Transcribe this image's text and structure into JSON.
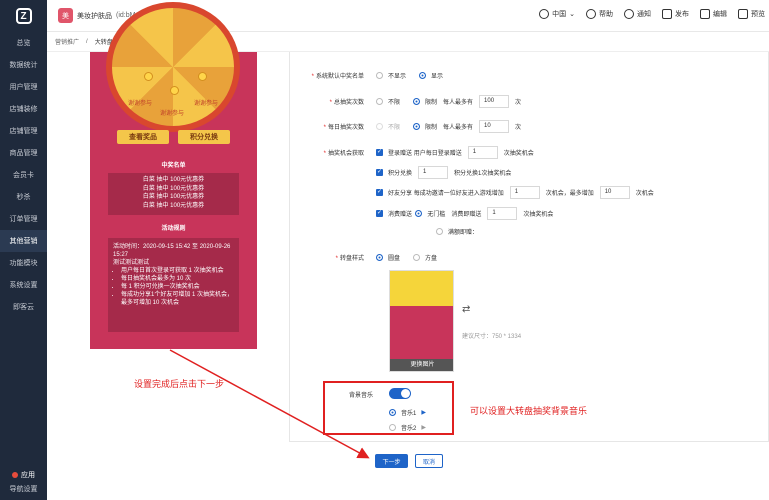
{
  "logo": "Z",
  "shop": {
    "avatar": "美",
    "name": "美妆护肤品",
    "id": "(id:bMvIMbn2Wr)"
  },
  "toolbar": {
    "region": "中国",
    "help": "帮助",
    "notice": "通知",
    "publish": "发布",
    "edit": "编辑",
    "preview": "预览"
  },
  "sidebar": {
    "items": [
      "总览",
      "数据统计",
      "用户管理",
      "店铺装修",
      "店铺管理",
      "商品管理",
      "会员卡",
      "秒杀",
      "订单管理",
      "其他营销",
      "功能模块",
      "系统设置",
      "即客云"
    ],
    "app": "应用",
    "cut": "导航设置"
  },
  "breadcrumb": {
    "parent": "营销推广",
    "sep": "/",
    "current": "大转盘"
  },
  "phone": {
    "wheel_text": [
      "谢谢参与",
      "谢谢参与",
      "谢谢参与"
    ],
    "btn_prize": "查看奖品",
    "btn_points": "积分兑换",
    "winners_title": "中奖名单",
    "winners": [
      "白菜 抽中 100元优惠券",
      "白菜 抽中 100元优惠券",
      "白菜 抽中 100元优惠券",
      "白菜 抽中 100元优惠券"
    ],
    "rules_title": "活动规则",
    "rules_time": "活动时间：2020-09-15 15:42 至 2020-09-26 15:27",
    "rules_desc": "测试测试测试",
    "rules_list": [
      "用户每日首次登录可获取 1 次抽奖机会",
      "每日抽奖机会最多为 10 次",
      "每 1 积分可兑换一次抽奖机会",
      "每成功分享1个好友可增加 1 次抽奖机会，最多可增加 10 次机会"
    ]
  },
  "form": {
    "show_list": {
      "label": "系统默认中奖名单",
      "opt_hide": "不显示",
      "opt_show": "显示"
    },
    "total": {
      "label": "总抽奖次数",
      "opt_unlimited": "不限",
      "opt_limit": "限制",
      "prefix": "每人最多有",
      "value": "100",
      "unit": "次"
    },
    "daily": {
      "label": "每日抽奖次数",
      "opt_unlimited": "不限",
      "opt_limit": "限制",
      "prefix": "每人最多有",
      "value": "10",
      "unit": "次"
    },
    "chance": {
      "label": "抽奖机会获取",
      "login": {
        "name": "登录赠送",
        "desc": "用户每日登录赠送",
        "value": "1",
        "suffix": "次抽奖机会"
      },
      "points": {
        "name": "积分兑换",
        "value": "1",
        "suffix": "积分兑换1次抽奖机会"
      },
      "share": {
        "name": "好友分享",
        "desc": "每成功邀请一位好友进入游戏增加",
        "value": "1",
        "mid": "次机会，最多增加",
        "value2": "10",
        "suffix": "次机会"
      },
      "consume": {
        "name": "消费赠送",
        "opt_no_threshold": "无门槛",
        "desc": "消费即赠送",
        "value": "1",
        "suffix": "次抽奖机会",
        "opt_full": "满额即赠："
      }
    },
    "style": {
      "label": "转盘样式",
      "opt_round": "圆盘",
      "opt_square": "方盘",
      "change_btn": "更换图片",
      "swap": "⇄",
      "hint": "建议尺寸：750 * 1334"
    },
    "music": {
      "label": "背景音乐",
      "opt1": "音乐1",
      "opt2": "音乐2",
      "play": "▶"
    },
    "next": "下一步",
    "cancel": "取消"
  },
  "annotations": {
    "left": "设置完成后点击下一步",
    "right": "可以设置大转盘抽奖背景音乐"
  },
  "colors": {
    "accent": "#1e64c8",
    "sidebar": "#1f2a3c",
    "phone": "#c8345a",
    "annotation": "#e02020"
  }
}
